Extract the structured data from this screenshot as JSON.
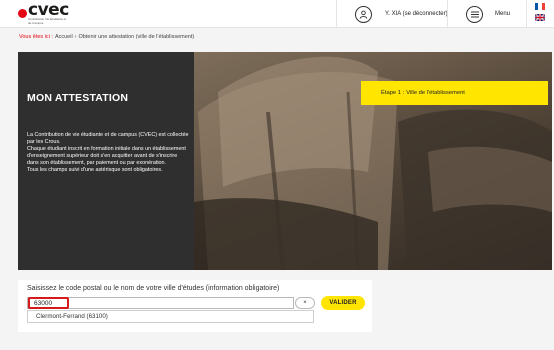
{
  "header": {
    "logo_text": "cvec",
    "logo_subtitle": "Contribution Vie Étudiante et de Campus",
    "user_label": "Y. XIA (se déconnecter)",
    "menu_label": "Menu"
  },
  "breadcrumb": {
    "here": "Vous êtes ici :",
    "items": [
      "Accueil",
      "›",
      "Obtenir une attestation (ville de l'établissement)"
    ]
  },
  "hero": {
    "title": "MON ATTESTATION",
    "paragraphs": [
      "La Contribution de vie étudiante et de campus (CVEC) est collectée par les Crous.",
      "Chaque étudiant inscrit en formation initiale dans un établissement d'enseignement supérieur doit s'en acquitter avant de s'inscrire dans son établissement, par paiement ou par exonération.",
      "Tous les champs suivi d'une astérisque sont obligatoires."
    ],
    "step_label": "Étape 1 :",
    "step_text": "Ville de l'établissement"
  },
  "form": {
    "label": "Saisissez le code postal ou le nom de votre ville d'études (information obligatoire)",
    "input_value": "63000",
    "clear_symbol": "×",
    "validate_label": "VALIDER",
    "suggestion": "Clermont-Ferrand (63100)"
  },
  "colors": {
    "brand_red": "#e30613",
    "accent_yellow": "#ffe500",
    "panel_dark": "#2f2f2f"
  }
}
